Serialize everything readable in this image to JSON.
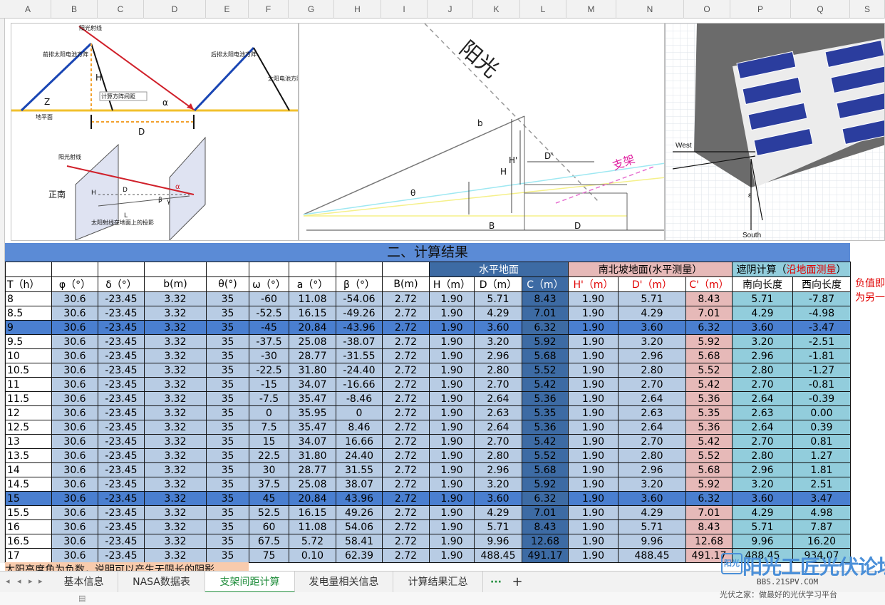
{
  "columns": [
    "A",
    "B",
    "C",
    "D",
    "E",
    "F",
    "G",
    "H",
    "I",
    "J",
    "K",
    "L",
    "M",
    "N",
    "O",
    "P",
    "Q",
    "S"
  ],
  "figure1": {
    "sun_ray": "阳光射线",
    "front_array": "前排太阳电池方阵",
    "rear_array": "后排太阳电池方阵",
    "bracket": "太阳电池方阵支架",
    "calc_spacing": "计算方阵间距",
    "ground": "地平面",
    "H": "H",
    "Z": "Z",
    "D": "D",
    "alpha": "α",
    "sun_ray2": "阳光射线",
    "south": "正南",
    "proj": "太阳射线在地面上的投影",
    "L": "L",
    "beta": "β",
    "gamma": "γ"
  },
  "figure2": {
    "sun": "阳光",
    "bracket": "支架",
    "b": "b",
    "theta": "θ",
    "H": "H",
    "Hp": "H'",
    "Dp": "D'",
    "B": "B",
    "D": "D"
  },
  "figure3": {
    "west": "West",
    "south": "South",
    "eps": "ε"
  },
  "table": {
    "title": "二、计算结果",
    "group_flat": "水平地面",
    "group_slope": "南北坡地面(水平测量）",
    "group_shade_a": "遮阴计算（",
    "group_shade_red": "沿地面测量",
    "group_shade_b": "）",
    "headers": [
      "T（h）",
      "φ（°）",
      "δ（°）",
      "b(m)",
      "θ(°)",
      "ω（°）",
      "a（°）",
      "β（°）",
      "B(m)",
      "H（m）",
      "D（m）",
      "C（m）",
      "H'（m）",
      "D'（m）",
      "C'（m）",
      "南向长度",
      "西向长度"
    ],
    "rows": [
      [
        "8",
        "30.6",
        "-23.45",
        "3.32",
        "35",
        "-60",
        "11.08",
        "-54.06",
        "2.72",
        "1.90",
        "5.71",
        "8.43",
        "1.90",
        "5.71",
        "8.43",
        "5.71",
        "-7.87"
      ],
      [
        "8.5",
        "30.6",
        "-23.45",
        "3.32",
        "35",
        "-52.5",
        "16.15",
        "-49.26",
        "2.72",
        "1.90",
        "4.29",
        "7.01",
        "1.90",
        "4.29",
        "7.01",
        "4.29",
        "-4.98"
      ],
      [
        "9",
        "30.6",
        "-23.45",
        "3.32",
        "35",
        "-45",
        "20.84",
        "-43.96",
        "2.72",
        "1.90",
        "3.60",
        "6.32",
        "1.90",
        "3.60",
        "6.32",
        "3.60",
        "-3.47"
      ],
      [
        "9.5",
        "30.6",
        "-23.45",
        "3.32",
        "35",
        "-37.5",
        "25.08",
        "-38.07",
        "2.72",
        "1.90",
        "3.20",
        "5.92",
        "1.90",
        "3.20",
        "5.92",
        "3.20",
        "-2.51"
      ],
      [
        "10",
        "30.6",
        "-23.45",
        "3.32",
        "35",
        "-30",
        "28.77",
        "-31.55",
        "2.72",
        "1.90",
        "2.96",
        "5.68",
        "1.90",
        "2.96",
        "5.68",
        "2.96",
        "-1.81"
      ],
      [
        "10.5",
        "30.6",
        "-23.45",
        "3.32",
        "35",
        "-22.5",
        "31.80",
        "-24.40",
        "2.72",
        "1.90",
        "2.80",
        "5.52",
        "1.90",
        "2.80",
        "5.52",
        "2.80",
        "-1.27"
      ],
      [
        "11",
        "30.6",
        "-23.45",
        "3.32",
        "35",
        "-15",
        "34.07",
        "-16.66",
        "2.72",
        "1.90",
        "2.70",
        "5.42",
        "1.90",
        "2.70",
        "5.42",
        "2.70",
        "-0.81"
      ],
      [
        "11.5",
        "30.6",
        "-23.45",
        "3.32",
        "35",
        "-7.5",
        "35.47",
        "-8.46",
        "2.72",
        "1.90",
        "2.64",
        "5.36",
        "1.90",
        "2.64",
        "5.36",
        "2.64",
        "-0.39"
      ],
      [
        "12",
        "30.6",
        "-23.45",
        "3.32",
        "35",
        "0",
        "35.95",
        "0",
        "2.72",
        "1.90",
        "2.63",
        "5.35",
        "1.90",
        "2.63",
        "5.35",
        "2.63",
        "0.00"
      ],
      [
        "12.5",
        "30.6",
        "-23.45",
        "3.32",
        "35",
        "7.5",
        "35.47",
        "8.46",
        "2.72",
        "1.90",
        "2.64",
        "5.36",
        "1.90",
        "2.64",
        "5.36",
        "2.64",
        "0.39"
      ],
      [
        "13",
        "30.6",
        "-23.45",
        "3.32",
        "35",
        "15",
        "34.07",
        "16.66",
        "2.72",
        "1.90",
        "2.70",
        "5.42",
        "1.90",
        "2.70",
        "5.42",
        "2.70",
        "0.81"
      ],
      [
        "13.5",
        "30.6",
        "-23.45",
        "3.32",
        "35",
        "22.5",
        "31.80",
        "24.40",
        "2.72",
        "1.90",
        "2.80",
        "5.52",
        "1.90",
        "2.80",
        "5.52",
        "2.80",
        "1.27"
      ],
      [
        "14",
        "30.6",
        "-23.45",
        "3.32",
        "35",
        "30",
        "28.77",
        "31.55",
        "2.72",
        "1.90",
        "2.96",
        "5.68",
        "1.90",
        "2.96",
        "5.68",
        "2.96",
        "1.81"
      ],
      [
        "14.5",
        "30.6",
        "-23.45",
        "3.32",
        "35",
        "37.5",
        "25.08",
        "38.07",
        "2.72",
        "1.90",
        "3.20",
        "5.92",
        "1.90",
        "3.20",
        "5.92",
        "3.20",
        "2.51"
      ],
      [
        "15",
        "30.6",
        "-23.45",
        "3.32",
        "35",
        "45",
        "20.84",
        "43.96",
        "2.72",
        "1.90",
        "3.60",
        "6.32",
        "1.90",
        "3.60",
        "6.32",
        "3.60",
        "3.47"
      ],
      [
        "15.5",
        "30.6",
        "-23.45",
        "3.32",
        "35",
        "52.5",
        "16.15",
        "49.26",
        "2.72",
        "1.90",
        "4.29",
        "7.01",
        "1.90",
        "4.29",
        "7.01",
        "4.29",
        "4.98"
      ],
      [
        "16",
        "30.6",
        "-23.45",
        "3.32",
        "35",
        "60",
        "11.08",
        "54.06",
        "2.72",
        "1.90",
        "5.71",
        "8.43",
        "1.90",
        "5.71",
        "8.43",
        "5.71",
        "7.87"
      ],
      [
        "16.5",
        "30.6",
        "-23.45",
        "3.32",
        "35",
        "67.5",
        "5.72",
        "58.41",
        "2.72",
        "1.90",
        "9.96",
        "12.68",
        "1.90",
        "9.96",
        "12.68",
        "9.96",
        "16.20"
      ],
      [
        "17",
        "30.6",
        "-23.45",
        "3.32",
        "35",
        "75",
        "0.10",
        "62.39",
        "2.72",
        "1.90",
        "488.45",
        "491.17",
        "1.90",
        "488.45",
        "491.17",
        "488.45",
        "934.07"
      ]
    ],
    "highlight_rows": [
      2,
      14
    ],
    "side_note": [
      "负值即",
      "为另一"
    ],
    "bottom_note": "太阳高度角为负数，说明可以产生无限长的阴影"
  },
  "tabs": [
    "基本信息",
    "NASA数据表",
    "支架间距计算",
    "发电量相关信息",
    "计算结果汇总"
  ],
  "active_tab": "支架间距计算",
  "tab_more": "···",
  "tab_add": "+",
  "watermark": {
    "logo": "阳光",
    "main": "阳光工匠光伏论坛",
    "url": "BBS.21SPV.COM",
    "sub": "光伏之家：做最好的光伏学习平台"
  },
  "colors": {
    "header_blue": "#5b8bd6",
    "cell_blue": "#b8cce4",
    "dark_blue": "#3d6ba4",
    "pink": "#e6b9b8",
    "teal": "#92cddc",
    "active_tab": "#1e8c3a"
  }
}
